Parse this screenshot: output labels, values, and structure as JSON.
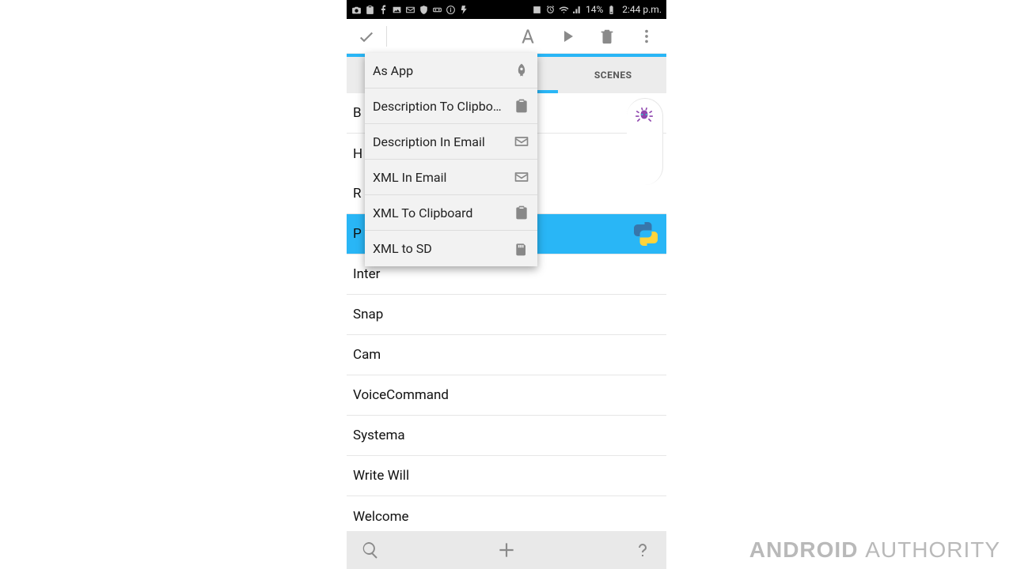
{
  "status_bar": {
    "battery_pct": "14%",
    "time": "2:44 p.m."
  },
  "tabs": {
    "right": "SCENES"
  },
  "list": {
    "items": [
      {
        "label": "B"
      },
      {
        "label": "H"
      },
      {
        "label": "R"
      },
      {
        "label": "P"
      },
      {
        "label": "Inter"
      },
      {
        "label": "Snap"
      },
      {
        "label": "Cam"
      },
      {
        "label": "VoiceCommand"
      },
      {
        "label": "Systema"
      },
      {
        "label": "Write Will"
      },
      {
        "label": "Welcome"
      }
    ],
    "selected_index": 3
  },
  "popup": {
    "items": [
      {
        "label": "As App",
        "icon": "rocket-icon"
      },
      {
        "label": "Description To Clipboard",
        "icon": "clipboard-icon"
      },
      {
        "label": "Description In Email",
        "icon": "email-icon"
      },
      {
        "label": "XML In Email",
        "icon": "email-icon"
      },
      {
        "label": "XML To Clipboard",
        "icon": "clipboard-icon"
      },
      {
        "label": "XML to SD",
        "icon": "sd-icon"
      }
    ]
  },
  "watermark": {
    "brand1": "ANDROID ",
    "brand2": "AUTHORITY"
  }
}
